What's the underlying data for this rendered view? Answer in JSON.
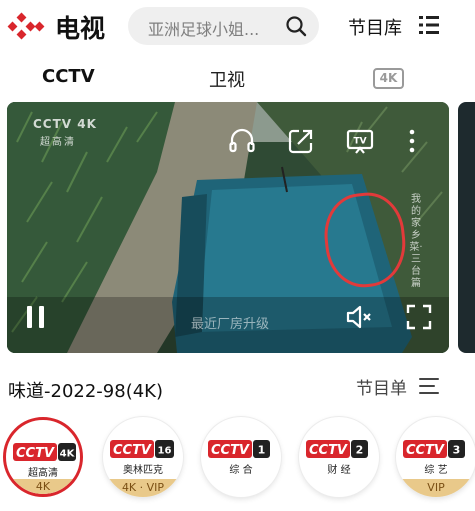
{
  "header": {
    "title": "电视",
    "search_placeholder": "亚洲足球小姐...",
    "library_label": "节目库"
  },
  "tabs": [
    {
      "label": "CCTV",
      "active": true
    },
    {
      "label": "卫视",
      "active": false
    },
    {
      "label": "4K",
      "active": false
    }
  ],
  "player": {
    "watermark_logo": "CCTV 4K",
    "watermark_sub": "超高清",
    "subtitle": "最近厂房升级",
    "side_caption": "我的家乡菜·三台篇",
    "annotation_color": "#e23a3a"
  },
  "program": {
    "title": "味道-2022-98(4K)",
    "list_label": "节目单"
  },
  "channels": [
    {
      "logo": "CCTV 4K",
      "sub": "超高清",
      "badge": "4K",
      "selected": true
    },
    {
      "logo": "CCTV 16",
      "sub": "奥林匹克",
      "badge": "4K · VIP",
      "selected": false
    },
    {
      "logo": "CCTV 1",
      "sub": "综 合",
      "badge": "",
      "selected": false
    },
    {
      "logo": "CCTV 2",
      "sub": "财 经",
      "badge": "",
      "selected": false
    },
    {
      "logo": "CCTV 3",
      "sub": "综 艺",
      "badge": "VIP",
      "selected": false
    }
  ],
  "colors": {
    "brand_red": "#d9262c",
    "badge_gold": "#e9c98a"
  }
}
